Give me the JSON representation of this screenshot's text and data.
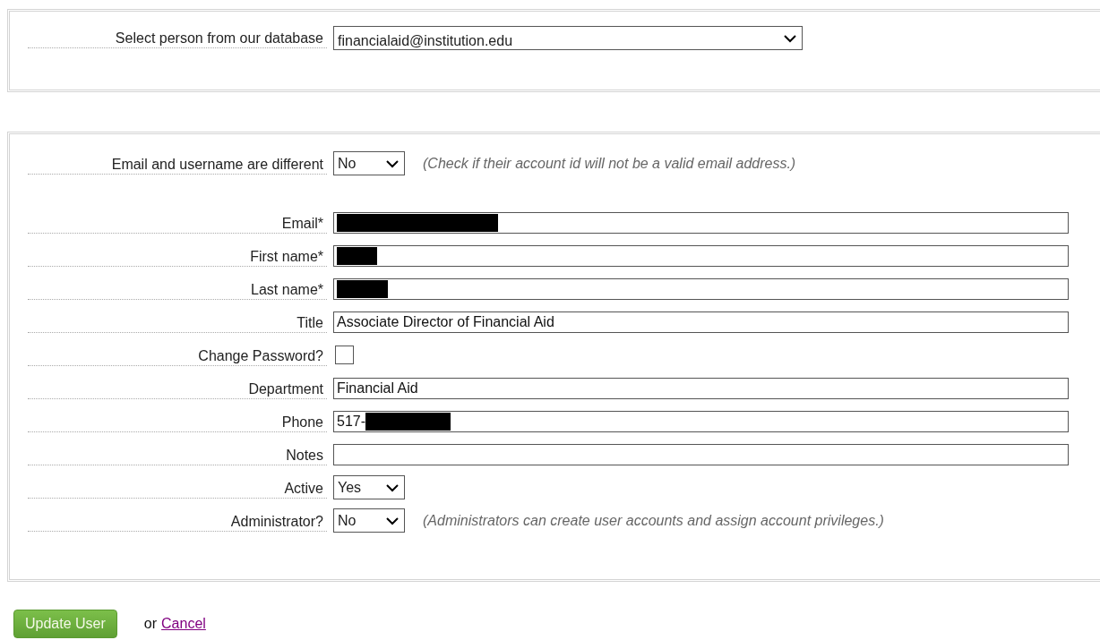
{
  "person_select": {
    "label": "Select person from our database",
    "value": "financialaid@institution.edu"
  },
  "fields": [
    {
      "kind": "select",
      "label": "Email and username are different",
      "value": "No",
      "hint": "(Check if their account id will not be a valid email address.)"
    },
    {
      "kind": "text",
      "label": "Email*",
      "redacted": true
    },
    {
      "kind": "text",
      "label": "First name*",
      "redacted": true
    },
    {
      "kind": "text",
      "label": "Last name*",
      "redacted": true
    },
    {
      "kind": "text",
      "label": "Title",
      "value": "Associate Director of Financial Aid"
    },
    {
      "kind": "checkbox",
      "label": "Change Password?",
      "checked": false
    },
    {
      "kind": "text",
      "label": "Department",
      "value": "Financial Aid"
    },
    {
      "kind": "text",
      "label": "Phone",
      "value": "517-",
      "redacted": true
    },
    {
      "kind": "text",
      "label": "Notes"
    },
    {
      "kind": "select",
      "label": "Active",
      "value": "Yes"
    },
    {
      "kind": "select",
      "label": "Administrator?",
      "value": "No",
      "hint": "(Administrators can create user accounts and assign account privileges.)"
    }
  ],
  "submit": {
    "label": "Update User"
  },
  "alt": {
    "text": "or",
    "link": "Cancel"
  }
}
